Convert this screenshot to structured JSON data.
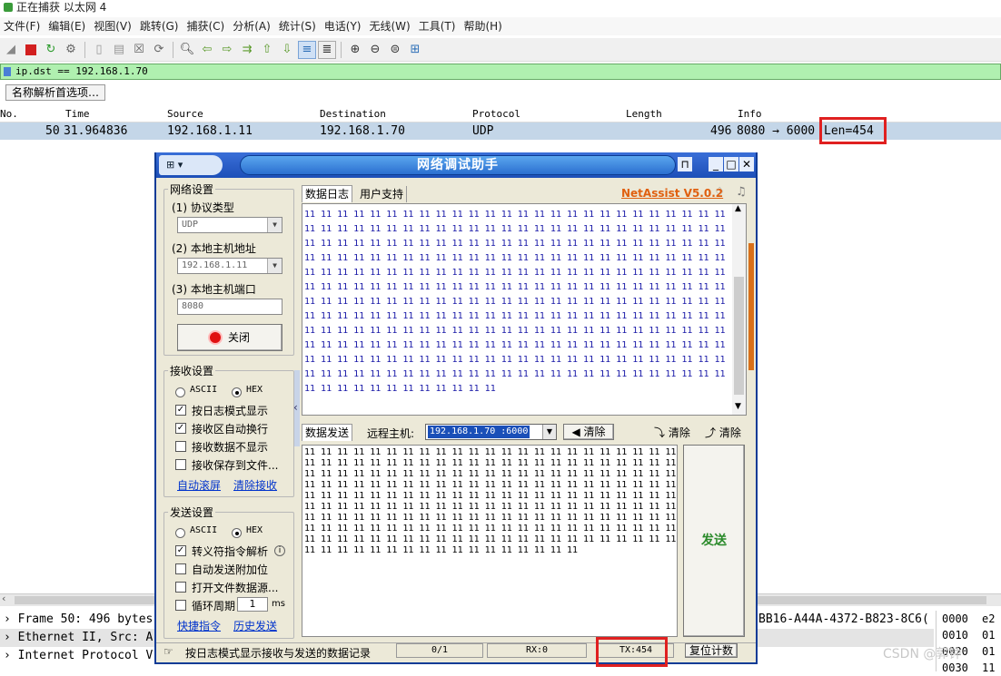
{
  "wireshark": {
    "title": "正在捕获 以太网 4",
    "menu": [
      "文件(F)",
      "编辑(E)",
      "视图(V)",
      "跳转(G)",
      "捕获(C)",
      "分析(A)",
      "统计(S)",
      "电话(Y)",
      "无线(W)",
      "工具(T)",
      "帮助(H)"
    ],
    "filter": "ip.dst == 192.168.1.70",
    "resolve_button": "名称解析首选项…",
    "columns": [
      "No.",
      "Time",
      "Source",
      "Destination",
      "Protocol",
      "Length",
      "Info"
    ],
    "row": {
      "no": "50",
      "time": "31.964836",
      "source": "192.168.1.11",
      "destination": "192.168.1.70",
      "protocol": "UDP",
      "length": "496",
      "info": "8080 → 6000",
      "len_label": "Len=454"
    },
    "details": [
      "Frame 50: 496 bytes",
      "Ethernet II, Src: A",
      "Internet Protocol V"
    ],
    "detail_right": "BB16-A44A-4372-B823-8C6(",
    "hex": [
      {
        "off": "0000",
        "b": "e2"
      },
      {
        "off": "0010",
        "b": "01"
      },
      {
        "off": "0020",
        "b": "01"
      },
      {
        "off": "0030",
        "b": "11"
      }
    ],
    "watermark": "CSDN @郭钟"
  },
  "netassist": {
    "title": "网络调试助手",
    "brand": "NetAssist V5.0.2",
    "net_settings": {
      "caption": "网络设置",
      "protocol_label": "(1) 协议类型",
      "protocol_value": "UDP",
      "host_label": "(2) 本地主机地址",
      "host_value": "192.168.1.11",
      "port_label": "(3) 本地主机端口",
      "port_value": "8080",
      "close_button": "关闭"
    },
    "recv_settings": {
      "caption": "接收设置",
      "ascii": "ASCII",
      "hex": "HEX",
      "options": [
        "按日志模式显示",
        "接收区自动换行",
        "接收数据不显示",
        "接收保存到文件..."
      ],
      "checked": [
        true,
        true,
        false,
        false
      ],
      "link1": "自动滚屏",
      "link2": "清除接收"
    },
    "send_settings": {
      "caption": "发送设置",
      "ascii": "ASCII",
      "hex": "HEX",
      "options": [
        "转义符指令解析",
        "自动发送附加位",
        "打开文件数据源...",
        "循环周期"
      ],
      "checked": [
        true,
        false,
        false,
        false
      ],
      "period_value": "1",
      "period_unit": "ms",
      "link1": "快捷指令",
      "link2": "历史发送"
    },
    "recv_tabs": [
      "数据日志",
      "用户支持"
    ],
    "recv_line": "11 11 11 11 11 11 11 11 11 11 11 11 11 11 11 11 11 11 11 11 11 11 11 11 11 11",
    "recv_last": "11 11 11 11 11 11 11 11 11 11 11 11",
    "recv_full_lines": 12,
    "send_tab": "数据发送",
    "remote_label": "远程主机:",
    "remote_value": "192.168.1.70 :6000",
    "clear_label": "清除",
    "clear1": "清除",
    "clear2": "清除",
    "send_button": "发送",
    "send_line": "11 11 11 11 11 11 11 11 11 11 11 11 11 11 11 11 11 11 11 11 11 11 11",
    "send_last": "11 11 11 11 11 11 11 11 11 11 11 11 11 11 11 11 11",
    "send_full_lines": 9,
    "status_text": "按日志模式显示接收与发送的数据记录",
    "status_count": "0/1",
    "status_rx": "RX:0",
    "status_tx": "TX:454",
    "reset_button": "复位计数"
  }
}
